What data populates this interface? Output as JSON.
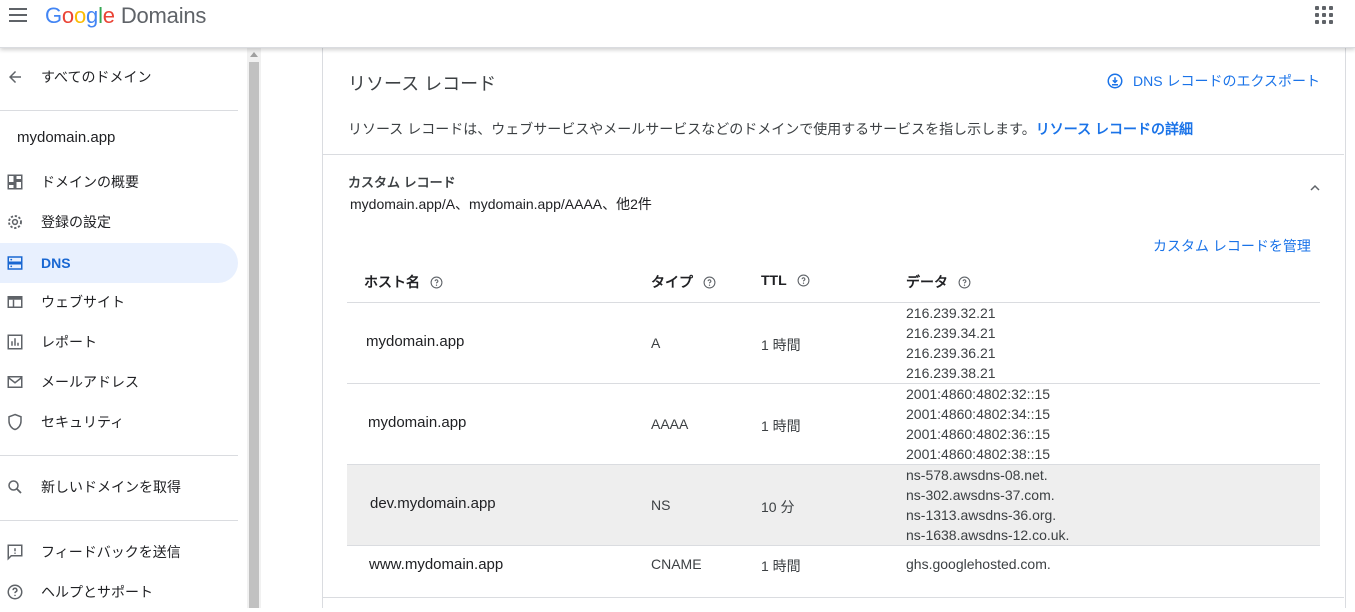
{
  "header": {
    "logo_google": [
      "G",
      "o",
      "o",
      "g",
      "l",
      "e"
    ],
    "logo_domains": "Domains"
  },
  "sidebar": {
    "back_label": "すべてのドメイン",
    "domain": "mydomain.app",
    "items": [
      {
        "label": "ドメインの概要",
        "icon": "dashboard-icon"
      },
      {
        "label": "登録の設定",
        "icon": "gear-icon"
      },
      {
        "label": "DNS",
        "icon": "dns-icon",
        "active": true
      },
      {
        "label": "ウェブサイト",
        "icon": "web-icon"
      },
      {
        "label": "レポート",
        "icon": "chart-icon"
      },
      {
        "label": "メールアドレス",
        "icon": "mail-icon"
      },
      {
        "label": "セキュリティ",
        "icon": "shield-icon"
      }
    ],
    "new_domain": "新しいドメインを取得",
    "feedback": "フィードバックを送信",
    "help": "ヘルプとサポート"
  },
  "main": {
    "title": "リソース レコード",
    "export_label": "DNS レコードのエクスポート",
    "description": "リソース レコードは、ウェブサービスやメールサービスなどのドメインで使用するサービスを指し示します。",
    "description_link": "リソース レコードの詳細",
    "custom_title": "カスタム レコード",
    "custom_summary": "mydomain.app/A、mydomain.app/AAAA、他2件",
    "manage_link": "カスタム レコードを管理",
    "columns": {
      "host": "ホスト名",
      "type": "タイプ",
      "ttl": "TTL",
      "data": "データ"
    },
    "records": [
      {
        "host": "mydomain.app",
        "type": "A",
        "ttl": "1 時間",
        "data": [
          "216.239.32.21",
          "216.239.34.21",
          "216.239.36.21",
          "216.239.38.21"
        ]
      },
      {
        "host": "mydomain.app",
        "type": "AAAA",
        "ttl": "1 時間",
        "data": [
          "2001:4860:4802:32::15",
          "2001:4860:4802:34::15",
          "2001:4860:4802:36::15",
          "2001:4860:4802:38::15"
        ]
      },
      {
        "host": "dev.mydomain.app",
        "type": "NS",
        "ttl": "10 分",
        "data": [
          "ns-578.awsdns-08.net.",
          "ns-302.awsdns-37.com.",
          "ns-1313.awsdns-36.org.",
          "ns-1638.awsdns-12.co.uk."
        ]
      },
      {
        "host": "www.mydomain.app",
        "type": "CNAME",
        "ttl": "1 時間",
        "data": [
          "ghs.googlehosted.com."
        ]
      }
    ]
  },
  "colors": {
    "accent": "#1a73e8",
    "active_bg": "#e8f0fe",
    "highlight_row": "#eeeeee"
  }
}
